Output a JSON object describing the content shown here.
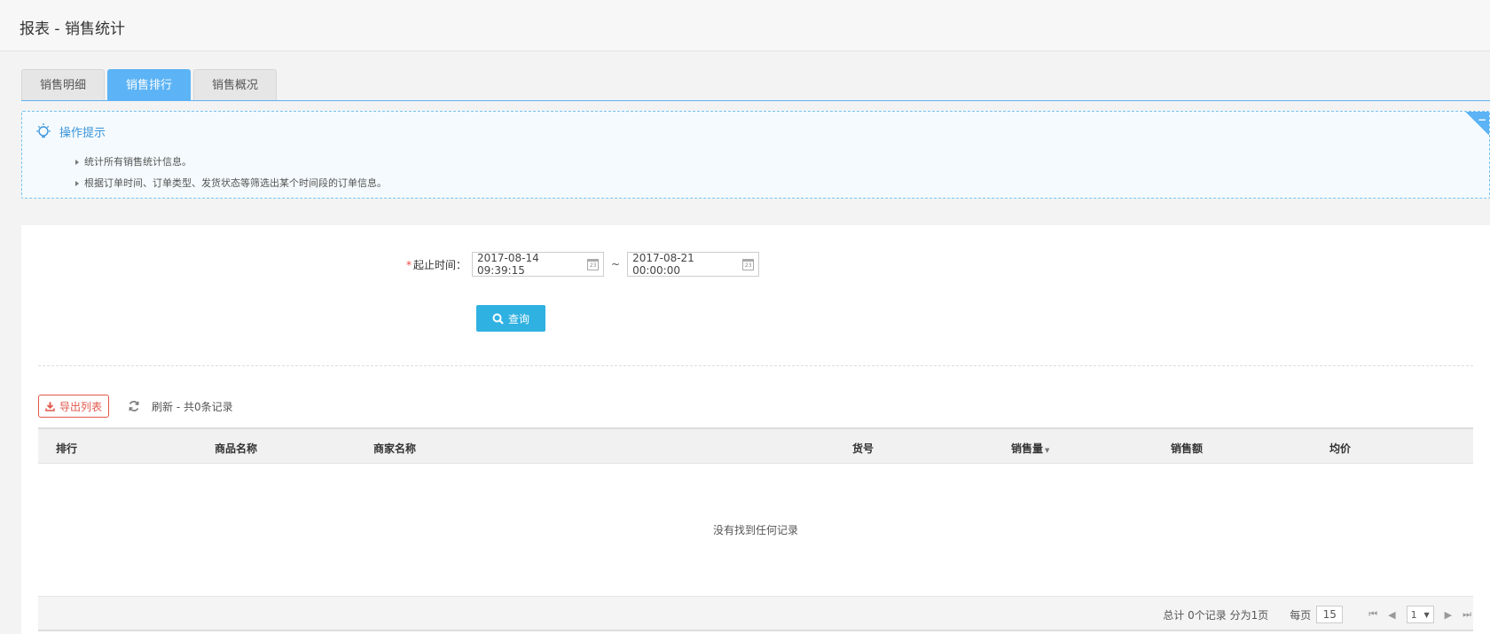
{
  "header": {
    "title": "报表 - 销售统计"
  },
  "tabs": [
    {
      "label": "销售明细",
      "active": false
    },
    {
      "label": "销售排行",
      "active": true
    },
    {
      "label": "销售概况",
      "active": false
    }
  ],
  "tips": {
    "title": "操作提示",
    "collapse_glyph": "−",
    "items": [
      "统计所有销售统计信息。",
      "根据订单时间、订单类型、发货状态等筛选出某个时间段的订单信息。"
    ]
  },
  "filter": {
    "required_mark": "*",
    "label": "起止时间：",
    "start": "2017-08-14 09:39:15",
    "separator": "~",
    "end": "2017-08-21 00:00:00",
    "calendar_day": "23",
    "search_label": "查询"
  },
  "toolbar": {
    "export_label": "导出列表",
    "refresh_label": "刷新",
    "record_summary": " - 共0条记录"
  },
  "table": {
    "columns": [
      "排行",
      "商品名称",
      "商家名称",
      "货号",
      "销售量",
      "销售额",
      "均价"
    ],
    "sort_indicator": "▼",
    "empty_text": "没有找到任何记录"
  },
  "pager": {
    "summary": "总计 0个记录 分为1页",
    "per_page_label": "每页",
    "per_page": "15",
    "current_page": "1"
  },
  "colors": {
    "accent": "#5cb3f5",
    "primary_button": "#2fb1e1",
    "danger": "#e2574c"
  }
}
